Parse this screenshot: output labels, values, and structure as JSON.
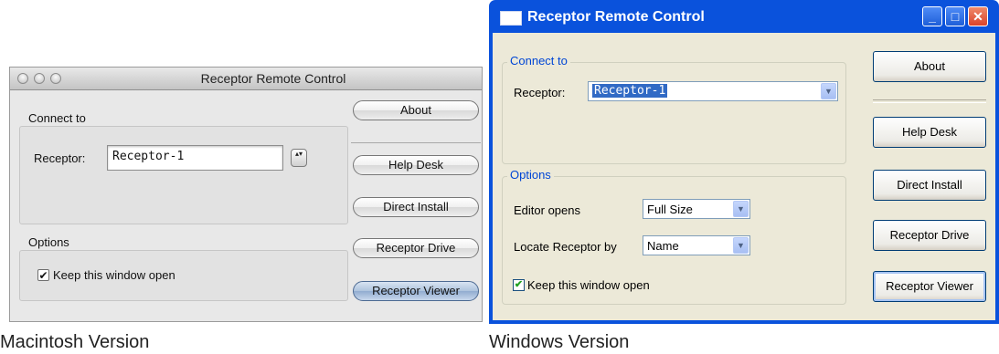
{
  "mac": {
    "title": "Receptor Remote Control",
    "connect_label": "Connect to",
    "receptor_label": "Receptor:",
    "receptor_value": "Receptor-1",
    "options_label": "Options",
    "keep_open_label": "Keep this window open",
    "keep_open_checked": "✔",
    "stepper_glyph": "▴▾",
    "buttons": {
      "about": "About",
      "help_desk": "Help Desk",
      "direct_install": "Direct Install",
      "receptor_drive": "Receptor Drive",
      "receptor_viewer": "Receptor Viewer"
    }
  },
  "win": {
    "title": "Receptor Remote Control",
    "controls": {
      "minimize": "_",
      "maximize": "□",
      "close": "✕"
    },
    "connect_label": "Connect to",
    "receptor_label": "Receptor:",
    "receptor_value": "Receptor-1",
    "options_label": "Options",
    "editor_opens_label": "Editor opens",
    "editor_opens_value": "Full Size",
    "locate_label": "Locate Receptor by",
    "locate_value": "Name",
    "keep_open_label": "Keep this window open",
    "keep_open_checked": "✔",
    "dropdown_arrow": "▼",
    "buttons": {
      "about": "About",
      "help_desk": "Help Desk",
      "direct_install": "Direct Install",
      "receptor_drive": "Receptor Drive",
      "receptor_viewer": "Receptor Viewer"
    }
  },
  "captions": {
    "mac": "Macintosh Version",
    "windows": "Windows Version"
  }
}
